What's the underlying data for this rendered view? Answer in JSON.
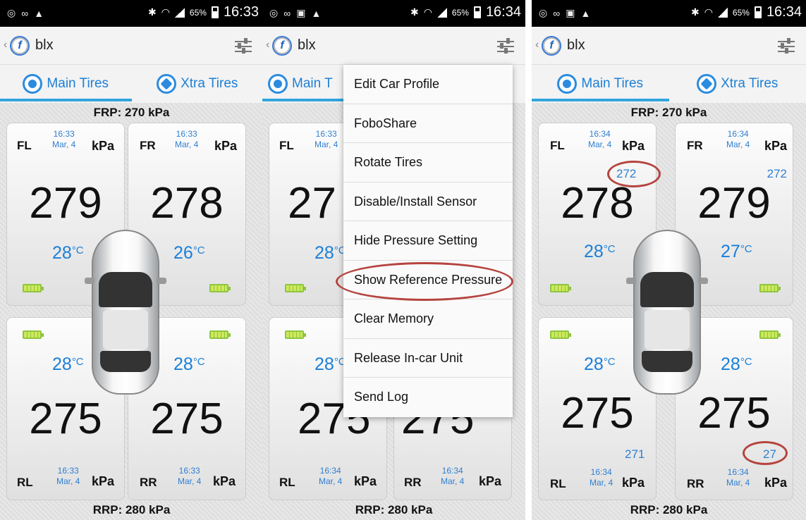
{
  "screens": [
    {
      "status": {
        "time": "16:33",
        "battery": "65%"
      },
      "app": {
        "title": "blx"
      },
      "tabs": [
        {
          "label": "Main Tires"
        },
        {
          "label": "Xtra Tires"
        }
      ],
      "front_ref": "FRP: 270 kPa",
      "rear_ref": "RRP: 280 kPa",
      "tires": {
        "fl": {
          "pos": "FL",
          "time": "16:33",
          "date": "Mar, 4",
          "unit": "kPa",
          "pressure": "279",
          "temp": "28",
          "temp_unit": "°C"
        },
        "fr": {
          "pos": "FR",
          "time": "16:33",
          "date": "Mar, 4",
          "unit": "kPa",
          "pressure": "278",
          "temp": "26",
          "temp_unit": "°C"
        },
        "rl": {
          "pos": "RL",
          "time": "16:33",
          "date": "Mar, 4",
          "unit": "kPa",
          "pressure": "275",
          "temp": "28",
          "temp_unit": "°C"
        },
        "rr": {
          "pos": "RR",
          "time": "16:33",
          "date": "Mar, 4",
          "unit": "kPa",
          "pressure": "275",
          "temp": "28",
          "temp_unit": "°C"
        }
      }
    },
    {
      "status": {
        "time": "16:34",
        "battery": "65%"
      },
      "app": {
        "title": "blx"
      },
      "tabs": [
        {
          "label": "Main T"
        }
      ],
      "rear_ref": "RRP: 280 kPa",
      "tires": {
        "fl": {
          "pos": "FL",
          "time": "16:33",
          "date": "Mar, 4",
          "pressure": "27",
          "temp": "28",
          "temp_unit": "°C"
        },
        "rl": {
          "pos": "RL",
          "time": "16:34",
          "date": "Mar, 4",
          "unit": "kPa",
          "pressure": "275",
          "temp": "28",
          "temp_unit": "°C"
        },
        "rr": {
          "pos": "RR",
          "time": "16:34",
          "date": "Mar, 4",
          "unit": "kPa",
          "pressure": "275"
        }
      },
      "menu": {
        "items": [
          {
            "label": "Edit Car Profile"
          },
          {
            "label": "FoboShare"
          },
          {
            "label": "Rotate Tires"
          },
          {
            "label": "Disable/Install Sensor"
          },
          {
            "label": "Hide Pressure Setting"
          },
          {
            "label": "Show Reference Pressure"
          },
          {
            "label": "Clear Memory"
          },
          {
            "label": "Release In-car Unit"
          },
          {
            "label": "Send Log"
          }
        ]
      }
    },
    {
      "status": {
        "time": "16:34",
        "battery": "65%"
      },
      "app": {
        "title": "blx"
      },
      "tabs": [
        {
          "label": "Main Tires"
        },
        {
          "label": "Xtra Tires"
        }
      ],
      "front_ref": "FRP: 270 kPa",
      "rear_ref": "RRP: 280 kPa",
      "tires": {
        "fl": {
          "pos": "FL",
          "time": "16:34",
          "date": "Mar, 4",
          "unit": "kPa",
          "pressure": "278",
          "temp": "28",
          "temp_unit": "°C",
          "ref": "272"
        },
        "fr": {
          "pos": "FR",
          "time": "16:34",
          "date": "Mar, 4",
          "unit": "kPa",
          "pressure": "279",
          "temp": "27",
          "temp_unit": "°C",
          "ref": "272"
        },
        "rl": {
          "pos": "RL",
          "time": "16:34",
          "date": "Mar, 4",
          "unit": "kPa",
          "pressure": "275",
          "temp": "28",
          "temp_unit": "°C",
          "ref": "271"
        },
        "rr": {
          "pos": "RR",
          "time": "16:34",
          "date": "Mar, 4",
          "unit": "kPa",
          "pressure": "275",
          "temp": "28",
          "temp_unit": "°C",
          "ref": "27"
        }
      }
    }
  ],
  "accent_colors": {
    "blue": "#1d7fd6",
    "tab_indicator": "#33a5de",
    "battery": "#8dc63f",
    "highlight": "#b5443f"
  }
}
